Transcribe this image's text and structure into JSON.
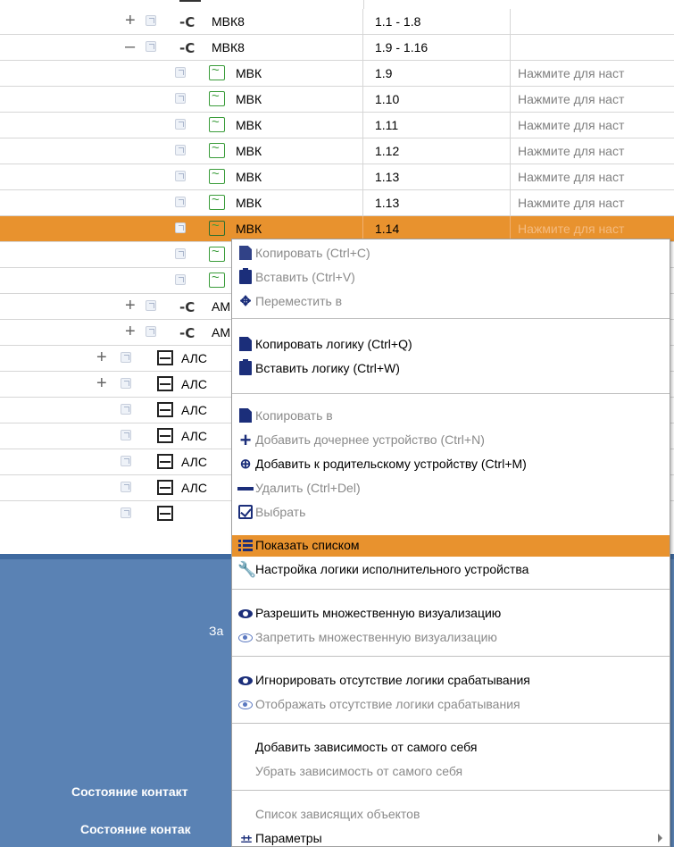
{
  "tree": {
    "rows": [
      {
        "label": "МВК8",
        "range": "1.1 - 1.8",
        "hint": ""
      },
      {
        "label": "МВК8",
        "range": "1.9 - 1.16",
        "hint": ""
      },
      {
        "label": "МВК",
        "range": "1.9",
        "hint": "Нажмите для наст"
      },
      {
        "label": "МВК",
        "range": "1.10",
        "hint": "Нажмите для наст"
      },
      {
        "label": "МВК",
        "range": "1.11",
        "hint": "Нажмите для наст"
      },
      {
        "label": "МВК",
        "range": "1.12",
        "hint": "Нажмите для наст"
      },
      {
        "label": "МВК",
        "range": "1.13",
        "hint": "Нажмите для наст"
      },
      {
        "label": "МВК",
        "range": "1.14",
        "hint": "Нажмите для наст"
      },
      {
        "label": "",
        "range": "",
        "hint": ""
      },
      {
        "label": "",
        "range": "",
        "hint": ""
      },
      {
        "label": "АМ",
        "range": "",
        "hint": ""
      },
      {
        "label": "АМ",
        "range": "",
        "hint": ""
      },
      {
        "label": "АЛС",
        "range": "",
        "hint": ""
      },
      {
        "label": "АЛС",
        "range": "",
        "hint": ""
      },
      {
        "label": "АЛС",
        "range": "",
        "hint": ""
      },
      {
        "label": "АЛС",
        "range": "",
        "hint": ""
      },
      {
        "label": "АЛС",
        "range": "",
        "hint": ""
      },
      {
        "label": "АЛС",
        "range": "",
        "hint": ""
      }
    ],
    "expand_plus": "+",
    "collapse_minus": "–"
  },
  "panel": {
    "partial_label": "За",
    "contact_state_1": "Состояние контакт",
    "contact_state_2": "Состояние контак"
  },
  "menu": {
    "items": [
      {
        "label": "Копировать (Ctrl+C)",
        "disabled": true,
        "icon": "copy-icon"
      },
      {
        "label": "Вставить (Ctrl+V)",
        "disabled": true,
        "icon": "paste-icon"
      },
      {
        "label": "Переместить в",
        "disabled": true,
        "icon": "move-icon"
      },
      {
        "label": "Копировать логику (Ctrl+Q)",
        "disabled": false,
        "icon": "copy-icon"
      },
      {
        "label": "Вставить логику (Ctrl+W)",
        "disabled": false,
        "icon": "paste-icon"
      },
      {
        "label": "Копировать в",
        "disabled": true,
        "icon": "copy-icon"
      },
      {
        "label": "Добавить дочернее устройство (Ctrl+N)",
        "disabled": true,
        "icon": "add-icon"
      },
      {
        "label": "Добавить к родительскому устройству (Ctrl+M)",
        "disabled": false,
        "icon": "add-to-parent-icon"
      },
      {
        "label": "Удалить (Ctrl+Del)",
        "disabled": true,
        "icon": "minus-icon"
      },
      {
        "label": "Выбрать",
        "disabled": true,
        "icon": "checkbox-icon"
      },
      {
        "label": "Показать списком",
        "disabled": false,
        "icon": "list-icon",
        "highlighted": true
      },
      {
        "label": "Настройка логики исполнительного устройства",
        "disabled": false,
        "icon": "wrench-icon"
      },
      {
        "label": "Разрешить множественную визуализацию",
        "disabled": false,
        "icon": "eye-icon"
      },
      {
        "label": "Запретить множественную визуализацию",
        "disabled": true,
        "icon": "eye-outline-icon"
      },
      {
        "label": "Игнорировать отсутствие логики срабатывания",
        "disabled": false,
        "icon": "eye-icon"
      },
      {
        "label": "Отображать отсутствие логики срабатывания",
        "disabled": true,
        "icon": "eye-outline-icon"
      },
      {
        "label": "Добавить зависимость от самого себя",
        "disabled": false,
        "icon": ""
      },
      {
        "label": "Убрать зависимость от самого себя",
        "disabled": true,
        "icon": ""
      },
      {
        "label": "Список зависящих объектов",
        "disabled": true,
        "icon": ""
      },
      {
        "label": "Параметры",
        "disabled": false,
        "icon": "parameters-icon",
        "submenu": true
      }
    ]
  },
  "colors": {
    "selection": "#e8922e",
    "panel_blue": "#5a82b4",
    "icon_blue": "#1b2e7a",
    "icon_green": "#3a9c3a"
  }
}
